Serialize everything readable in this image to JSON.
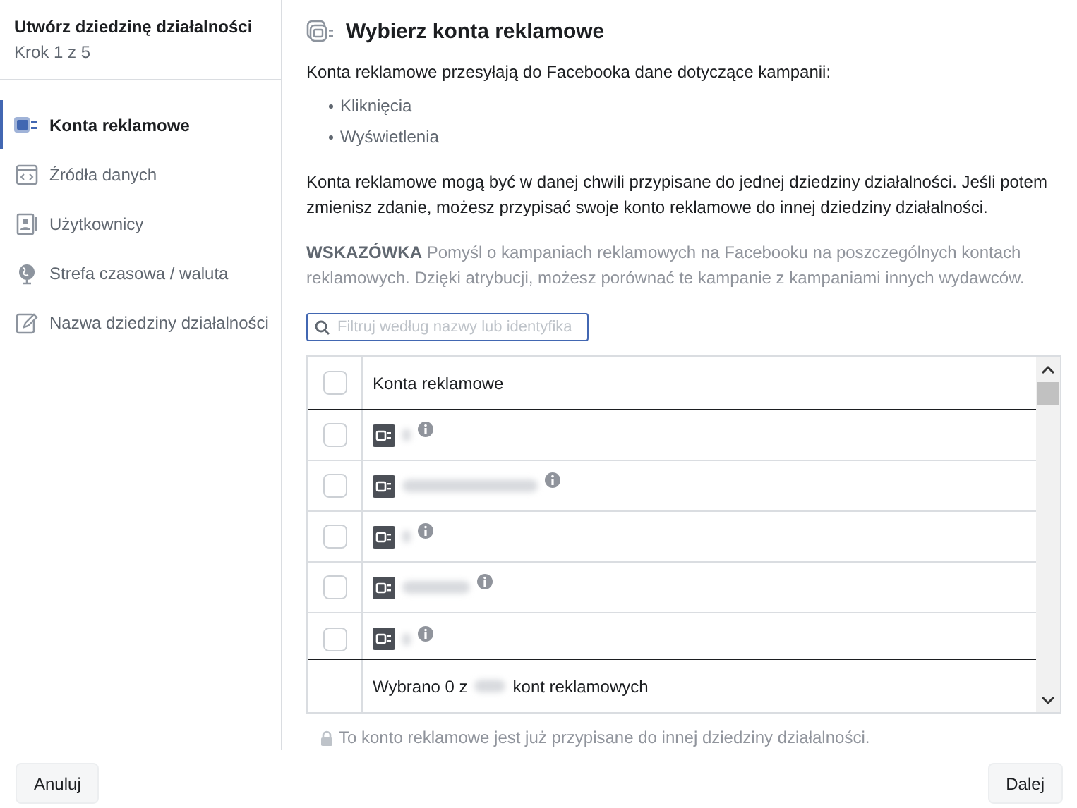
{
  "sidebar": {
    "title": "Utwórz dziedzinę działalności",
    "step": "Krok 1 z 5",
    "items": [
      {
        "label": "Konta reklamowe",
        "kind": "ads",
        "selected": true
      },
      {
        "label": "Źródła danych",
        "kind": "code",
        "selected": false
      },
      {
        "label": "Użytkownicy",
        "kind": "user",
        "selected": false
      },
      {
        "label": "Strefa czasowa / waluta",
        "kind": "globe",
        "selected": false
      },
      {
        "label": "Nazwa dziedziny działalności",
        "kind": "edit",
        "selected": false
      }
    ]
  },
  "main": {
    "title": "Wybierz konta reklamowe",
    "intro": "Konta reklamowe przesyłają do Facebooka dane dotyczące kampanii:",
    "bullets": [
      "Kliknięcia",
      "Wyświetlenia"
    ],
    "note": "Konta reklamowe mogą być w danej chwili przypisane do jednej dziedziny działalności. Jeśli potem zmienisz zdanie, możesz przypisać swoje konto reklamowe do innej dziedziny działalności.",
    "tip": "**WSKAZÓWKA** Pomyśl o kampaniach reklamowych na Facebooku na poszczególnych kontach reklamowych. Dzięki atrybucji, możesz porównać te kampanie z kampaniami innych wydawców.",
    "search": {
      "placeholder": "Filtruj według nazwy lub identyfika"
    },
    "table": {
      "header": "Konta reklamowe",
      "header_checked": false,
      "rows": [
        {
          "checked": false
        },
        {
          "checked": false
        },
        {
          "checked": false
        },
        {
          "checked": false
        },
        {
          "checked": false
        }
      ],
      "footer_before": "Wybrano 0 z",
      "footer_after": "kont reklamowych"
    },
    "lock_note": "To konto reklamowe jest już przypisane do innej dziedziny działalności."
  },
  "buttons": {
    "cancel": "Anuluj",
    "next": "Dalej"
  }
}
